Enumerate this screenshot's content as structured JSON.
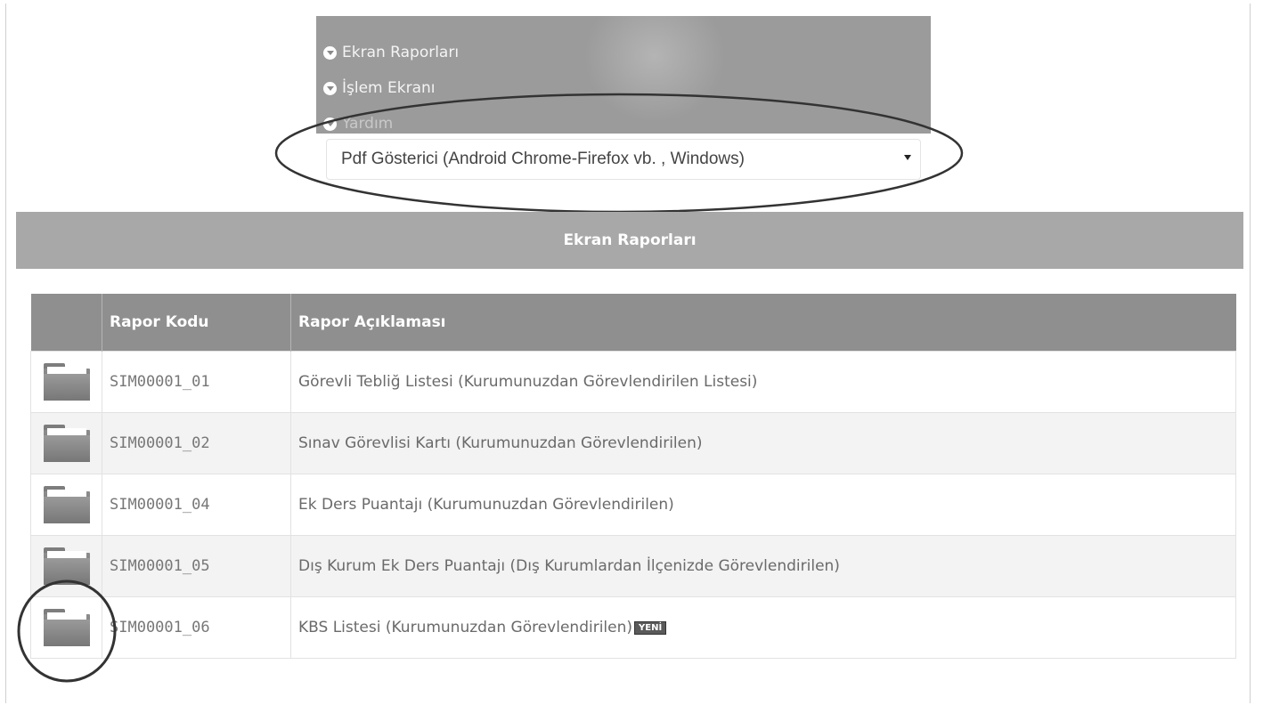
{
  "menu": {
    "items": [
      {
        "label": "Ekran Raporları"
      },
      {
        "label": "İşlem Ekranı"
      },
      {
        "label": "Yardım"
      }
    ]
  },
  "viewer_select": {
    "selected": "Pdf Gösterici (Android Chrome-Firefox vb. , Windows)"
  },
  "section": {
    "title": "Ekran Raporları"
  },
  "table": {
    "headers": {
      "icon": "",
      "code": "Rapor Kodu",
      "description": "Rapor Açıklaması"
    },
    "rows": [
      {
        "code": "SIM00001_01",
        "description": "Görevli Tebliğ Listesi (Kurumunuzdan Görevlendirilen Listesi)",
        "icon": "folder-icon"
      },
      {
        "code": "SIM00001_02",
        "description": "Sınav Görevlisi Kartı (Kurumunuzdan Görevlendirilen)",
        "icon": "folder-icon"
      },
      {
        "code": "SIM00001_04",
        "description": "Ek Ders Puantajı (Kurumunuzdan Görevlendirilen)",
        "icon": "folder-icon"
      },
      {
        "code": "SIM00001_05",
        "description": "Dış Kurum Ek Ders Puantajı (Dış Kurumlardan İlçenizde Görevlendirilen)",
        "icon": "folder-icon"
      },
      {
        "code": "SIM00001_06",
        "description": "KBS Listesi (Kurumunuzdan Görevlendirilen)",
        "icon": "folder-icon",
        "badge": "YENİ"
      }
    ]
  },
  "colors": {
    "menu_panel": "#9b9b9b",
    "section_bar": "#a8a8a8",
    "table_header": "#8f8f8f",
    "row_alt": "#f3f3f3"
  }
}
